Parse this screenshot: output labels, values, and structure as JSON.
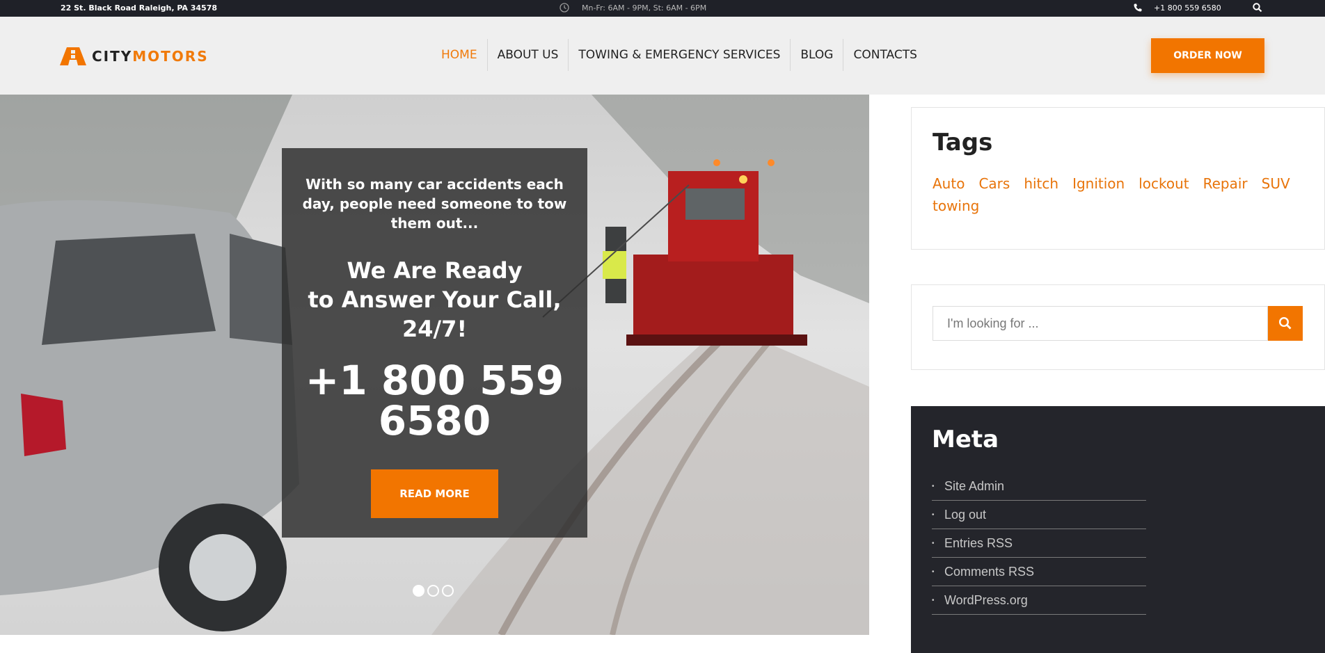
{
  "topbar": {
    "address": "22 St. Black Road Raleigh, PA 34578",
    "hours": "Mn-Fr: 6AM - 9PM, St: 6AM - 6PM",
    "phone": "+1 800 559 6580"
  },
  "header": {
    "logo": {
      "part1": "CITY",
      "part2": "MOTORS"
    },
    "nav": [
      "HOME",
      "ABOUT US",
      "TOWING & EMERGENCY SERVICES",
      "BLOG",
      "CONTACTS"
    ],
    "active_nav": "HOME",
    "order_label": "ORDER NOW"
  },
  "hero": {
    "intro": "With so many car accidents each day, people need someone to tow them out...",
    "title_line1": "We Are Ready",
    "title_line2": "to Answer Your Call,",
    "title_line3": "24/7!",
    "phone": "+1 800 559 6580",
    "button": "READ MORE",
    "slides": 3,
    "active_slide": 1
  },
  "sidebar": {
    "tags": {
      "title": "Tags",
      "items": [
        "Auto",
        "Cars",
        "hitch",
        "Ignition",
        "lockout",
        "Repair",
        "SUV",
        "towing"
      ]
    },
    "search": {
      "placeholder": "I'm looking for ..."
    },
    "meta": {
      "title": "Meta",
      "items": [
        "Site Admin",
        "Log out",
        "Entries RSS",
        "Comments RSS",
        "WordPress.org"
      ]
    }
  },
  "colors": {
    "accent": "#f27500",
    "topbar_bg": "#1f2128",
    "header_bg": "#efefef",
    "meta_bg": "#24252b"
  }
}
